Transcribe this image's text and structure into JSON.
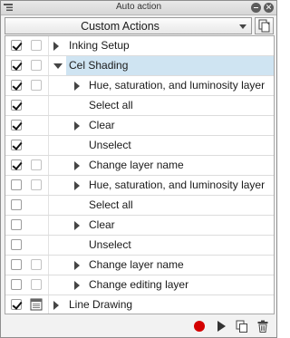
{
  "window": {
    "title": "Auto action"
  },
  "set_select": {
    "value": "Custom Actions"
  },
  "colors": {
    "selected_row": "#cfe4f2",
    "record_red": "#d40000"
  },
  "items": [
    {
      "label": "Inking Setup",
      "checked": true,
      "second": false,
      "disclosure": "collapsed",
      "level": 0
    },
    {
      "label": "Cel Shading",
      "checked": true,
      "second": false,
      "disclosure": "expanded",
      "level": 0,
      "selected": true
    },
    {
      "label": "Hue, saturation, and luminosity layer",
      "checked": true,
      "second": false,
      "disclosure": "collapsed",
      "level": 1
    },
    {
      "label": "Select all",
      "checked": true,
      "second": null,
      "disclosure": null,
      "level": 1
    },
    {
      "label": "Clear",
      "checked": true,
      "second": null,
      "disclosure": "collapsed",
      "level": 1
    },
    {
      "label": "Unselect",
      "checked": true,
      "second": null,
      "disclosure": null,
      "level": 1
    },
    {
      "label": "Change layer name",
      "checked": true,
      "second": false,
      "disclosure": "collapsed",
      "level": 1
    },
    {
      "label": "Hue, saturation, and luminosity layer",
      "checked": false,
      "second": false,
      "disclosure": "collapsed",
      "level": 1
    },
    {
      "label": "Select all",
      "checked": false,
      "second": null,
      "disclosure": null,
      "level": 1
    },
    {
      "label": "Clear",
      "checked": false,
      "second": null,
      "disclosure": "collapsed",
      "level": 1
    },
    {
      "label": "Unselect",
      "checked": false,
      "second": null,
      "disclosure": null,
      "level": 1
    },
    {
      "label": "Change layer name",
      "checked": false,
      "second": false,
      "disclosure": "collapsed",
      "level": 1
    },
    {
      "label": "Change editing layer",
      "checked": false,
      "second": false,
      "disclosure": "collapsed",
      "level": 1
    },
    {
      "label": "Line Drawing",
      "checked": true,
      "second": "dialog",
      "disclosure": "collapsed",
      "level": 0
    }
  ],
  "toolbar": {
    "buttons": [
      {
        "name": "record-icon"
      },
      {
        "name": "play-icon"
      },
      {
        "name": "duplicate-icon"
      },
      {
        "name": "trash-icon"
      }
    ]
  }
}
